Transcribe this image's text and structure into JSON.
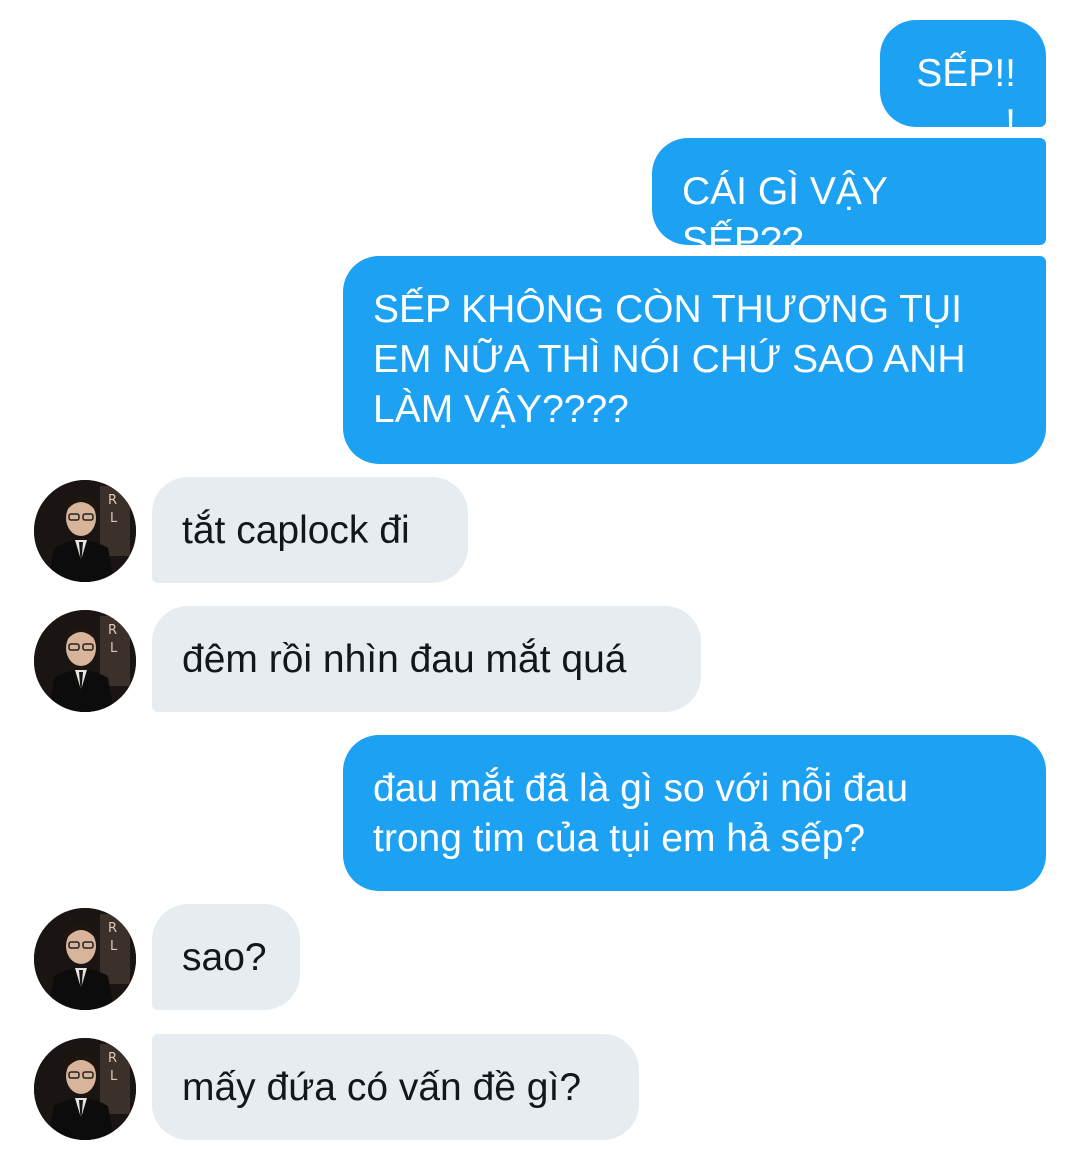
{
  "conversation": {
    "messages": [
      {
        "direction": "outgoing",
        "text": "SẾP!!!"
      },
      {
        "direction": "outgoing",
        "text": "CÁI GÌ VẬY SẾP??"
      },
      {
        "direction": "outgoing",
        "text": "SẾP KHÔNG CÒN THƯƠNG TỤI\nEM NỮA THÌ NÓI CHỨ SAO ANH\nLÀM VẬY????"
      },
      {
        "direction": "incoming",
        "text": "tắt caplock đi",
        "avatar": "user-avatar"
      },
      {
        "direction": "incoming",
        "text": "đêm rồi nhìn đau mắt quá",
        "avatar": "user-avatar"
      },
      {
        "direction": "outgoing",
        "text": "đau mắt đã là gì so với nỗi đau\ntrong tim của tụi em hả sếp?"
      },
      {
        "direction": "incoming",
        "text": "sao?",
        "avatar": "user-avatar"
      },
      {
        "direction": "incoming",
        "text": "mấy đứa có vấn đề gì?",
        "avatar": "user-avatar"
      }
    ]
  },
  "colors": {
    "outgoing_bubble": "#1da1f2",
    "incoming_bubble": "#e6ecf0",
    "background": "#ffffff"
  }
}
